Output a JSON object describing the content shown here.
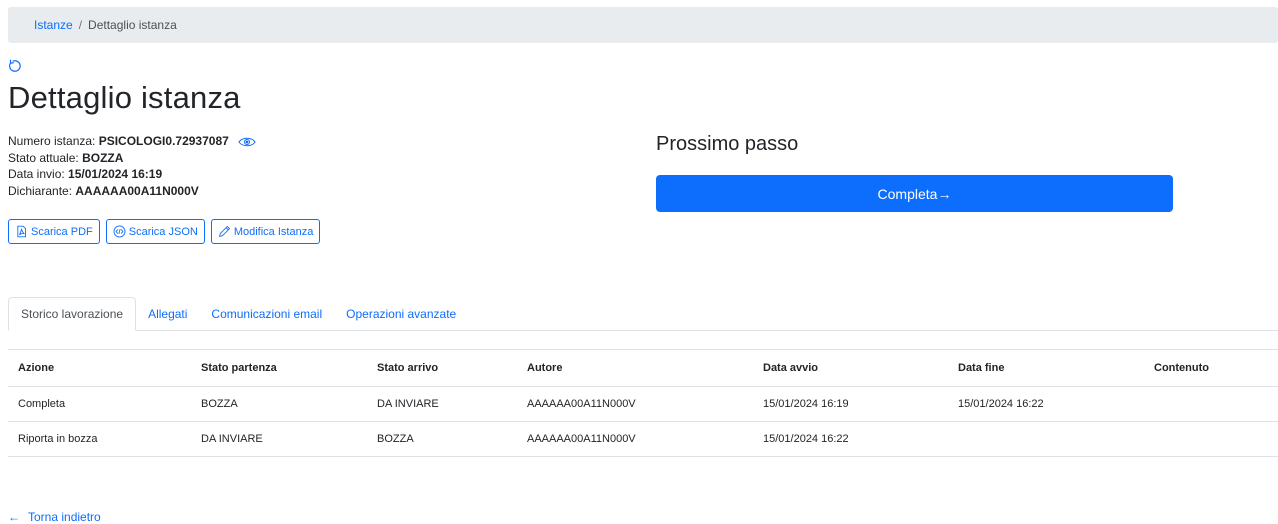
{
  "breadcrumb": {
    "link": "Istanze",
    "separator": "/",
    "current": "Dettaglio istanza"
  },
  "page_title": "Dettaglio istanza",
  "info": {
    "numero_label": "Numero istanza:",
    "numero_value": "PSICOLOGI0.72937087",
    "stato_label": "Stato attuale:",
    "stato_value": "BOZZA",
    "data_label": "Data invio:",
    "data_value": "15/01/2024 16:19",
    "dichiarante_label": "Dichiarante:",
    "dichiarante_value": "AAAAAA00A11N000V"
  },
  "actions": {
    "pdf": "Scarica PDF",
    "json": "Scarica JSON",
    "edit": "Modifica Istanza"
  },
  "next_step": {
    "title": "Prossimo passo",
    "button": "Completa→"
  },
  "tabs": [
    "Storico lavorazione",
    "Allegati",
    "Comunicazioni email",
    "Operazioni avanzate"
  ],
  "table": {
    "headers": [
      "Azione",
      "Stato partenza",
      "Stato arrivo",
      "Autore",
      "Data avvio",
      "Data fine",
      "Contenuto"
    ],
    "rows": [
      [
        "Completa",
        "BOZZA",
        "DA INVIARE",
        "AAAAAA00A11N000V",
        "15/01/2024 16:19",
        "15/01/2024 16:22",
        ""
      ],
      [
        "Riporta in bozza",
        "DA INVIARE",
        "BOZZA",
        "AAAAAA00A11N000V",
        "15/01/2024 16:22",
        "",
        ""
      ]
    ]
  },
  "back_link": {
    "arrow": "←",
    "label": "Torna indietro"
  },
  "colors": {
    "primary": "#0d6efd",
    "breadcrumb_bg": "#e9ecef",
    "border": "#dee2e6"
  }
}
